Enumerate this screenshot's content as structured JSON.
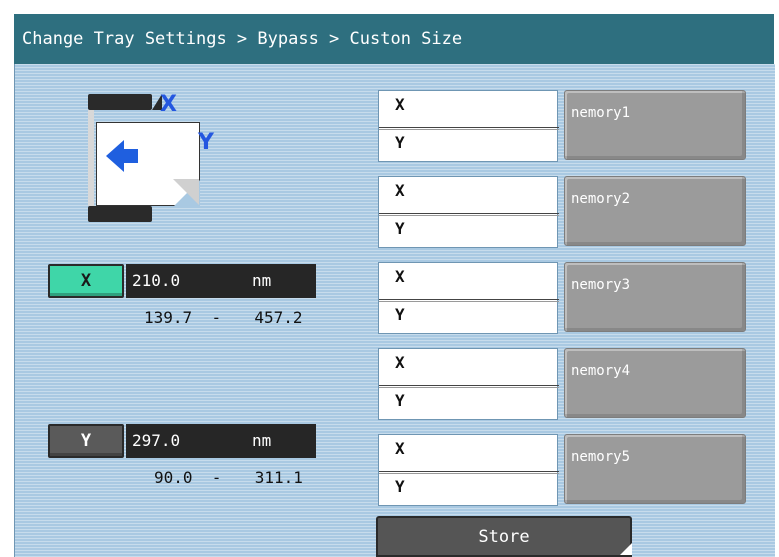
{
  "window": {
    "breadcrumb": "Change Tray Settings > Bypass > Custon Size"
  },
  "colors": {
    "title_bar": "#2e6f7f",
    "panel": "#a9c9e2",
    "active_button": "#3fd6a8",
    "arrow": "#1f5fdf"
  },
  "illustration": {
    "icon": "paper-feed-direction-icon",
    "x_label": "X",
    "y_label": "Y"
  },
  "x_setting": {
    "button_label": "X",
    "value": "210.0",
    "unit": "nm",
    "range_min": "139.7",
    "range_sep": "-",
    "range_max": "457.2"
  },
  "y_setting": {
    "button_label": "Y",
    "value": "297.0",
    "unit": "nm",
    "range_min": "90.0",
    "range_sep": "-",
    "range_max": "311.1"
  },
  "memories": [
    {
      "x_label": "X",
      "y_label": "Y",
      "button_label": "nemory1"
    },
    {
      "x_label": "X",
      "y_label": "Y",
      "button_label": "nemory2"
    },
    {
      "x_label": "X",
      "y_label": "Y",
      "button_label": "nemory3"
    },
    {
      "x_label": "X",
      "y_label": "Y",
      "button_label": "nemory4"
    },
    {
      "x_label": "X",
      "y_label": "Y",
      "button_label": "nemory5"
    }
  ],
  "store_label": "Store"
}
